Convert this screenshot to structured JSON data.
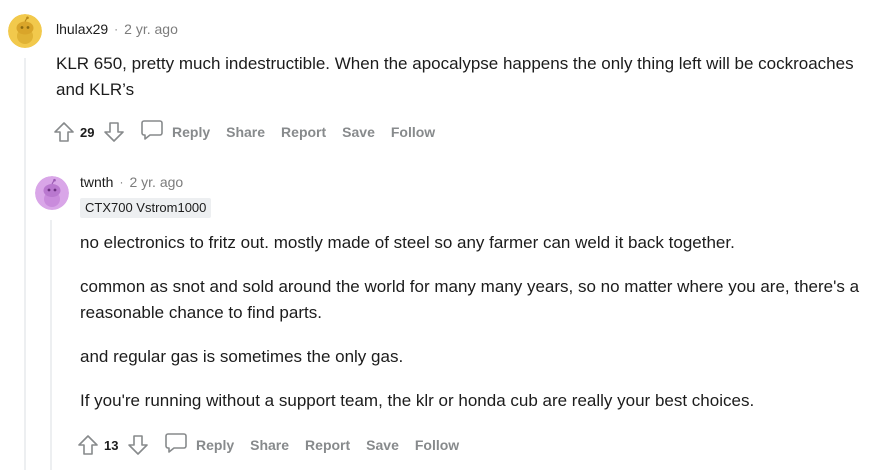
{
  "comments": [
    {
      "username": "lhulax29",
      "separator": "·",
      "time": "2 yr. ago",
      "avatar_color": "#f2c94c",
      "paragraphs": [
        "KLR 650, pretty much indestructible. When the apocalypse happens the only thing left will be cockroaches and KLR’s"
      ],
      "score": "29",
      "actions": {
        "reply": "Reply",
        "share": "Share",
        "report": "Report",
        "save": "Save",
        "follow": "Follow"
      }
    },
    {
      "username": "twnth",
      "separator": "·",
      "time": "2 yr. ago",
      "avatar_color": "#d9a6e8",
      "flair": "CTX700 Vstrom1000",
      "paragraphs": [
        "no electronics to fritz out. mostly made of steel so any farmer can weld it back together.",
        "common as snot and sold around the world for many many years, so no matter where you are, there's a reasonable chance to find parts.",
        "and regular gas is sometimes the only gas.",
        "If you're running without a support team, the klr or honda cub are really your best choices."
      ],
      "score": "13",
      "actions": {
        "reply": "Reply",
        "share": "Share",
        "report": "Report",
        "save": "Save",
        "follow": "Follow"
      }
    }
  ],
  "icons": {
    "upvote": "arrow-up-icon",
    "downvote": "arrow-down-icon",
    "reply": "speech-bubble-icon",
    "avatar": "snoo-avatar-icon"
  },
  "colors": {
    "muted_text": "#878a8c",
    "timestamp": "#7c7c7c",
    "thread_line": "#edeff1",
    "flair_bg": "#edeff1"
  }
}
